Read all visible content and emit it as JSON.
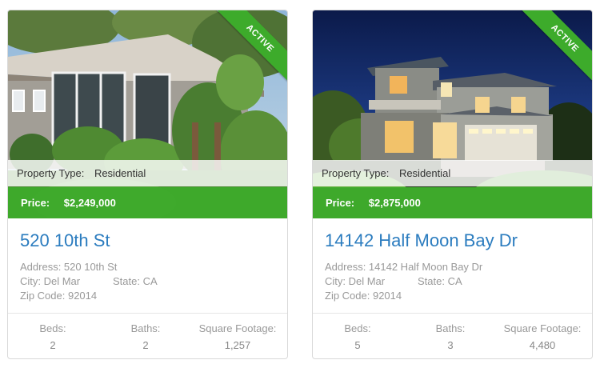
{
  "listings": [
    {
      "status": "ACTIVE",
      "property_type_label": "Property Type:",
      "property_type": "Residential",
      "price_label": "Price:",
      "price": "$2,249,000",
      "title": "520 10th St",
      "address_line": "Address: 520 10th St",
      "city_line": "City: Del Mar",
      "state_line": "State: CA",
      "zip_line": "Zip Code: 92014",
      "stats": [
        {
          "label": "Beds:",
          "value": "2"
        },
        {
          "label": "Baths:",
          "value": "2"
        },
        {
          "label": "Square Footage:",
          "value": "1,257"
        }
      ]
    },
    {
      "status": "ACTIVE",
      "property_type_label": "Property Type:",
      "property_type": "Residential",
      "price_label": "Price:",
      "price": "$2,875,000",
      "title": "14142 Half Moon Bay Dr",
      "address_line": "Address: 14142 Half Moon Bay Dr",
      "city_line": "City: Del Mar",
      "state_line": "State: CA",
      "zip_line": "Zip Code: 92014",
      "stats": [
        {
          "label": "Beds:",
          "value": "5"
        },
        {
          "label": "Baths:",
          "value": "3"
        },
        {
          "label": "Square Footage:",
          "value": "4,480"
        }
      ]
    }
  ],
  "colors": {
    "accent_green": "#3dab2b",
    "title_blue": "#2b7cbf",
    "muted_text": "#999999"
  }
}
